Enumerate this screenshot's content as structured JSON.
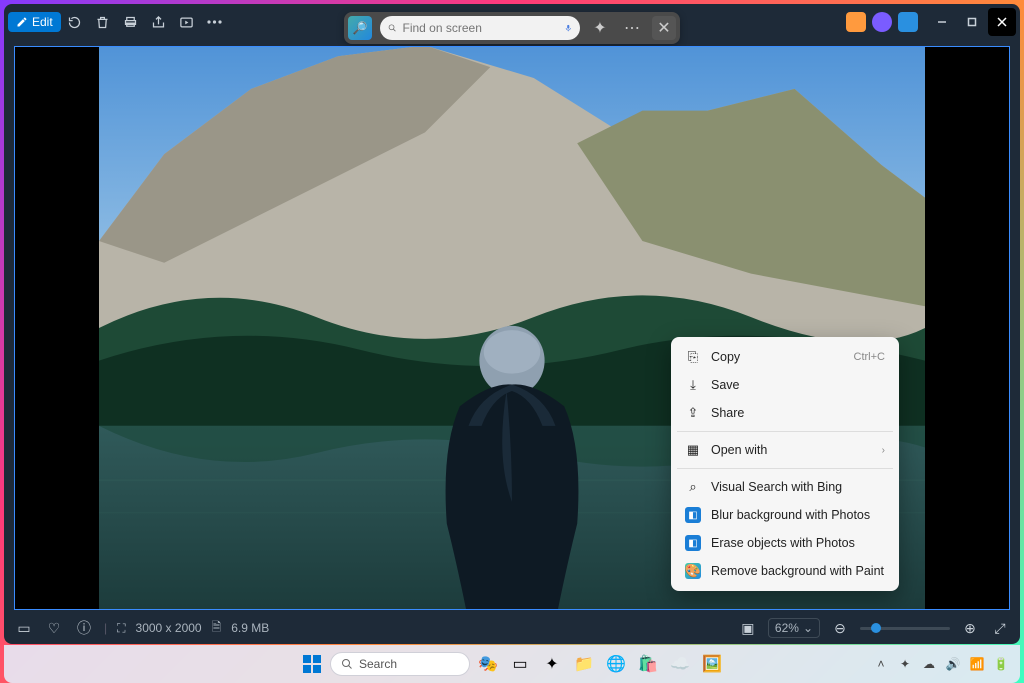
{
  "toolbar": {
    "edit_label": "Edit"
  },
  "search": {
    "placeholder": "Find on screen"
  },
  "context_menu": {
    "copy": "Copy",
    "copy_shortcut": "Ctrl+C",
    "save": "Save",
    "share": "Share",
    "open_with": "Open with",
    "visual_search": "Visual Search with Bing",
    "blur": "Blur background with Photos",
    "erase": "Erase objects with Photos",
    "remove_bg": "Remove background with Paint"
  },
  "status": {
    "dimensions": "3000 x 2000",
    "filesize": "6.9 MB",
    "zoom": "62%"
  },
  "taskbar": {
    "search_label": "Search"
  }
}
